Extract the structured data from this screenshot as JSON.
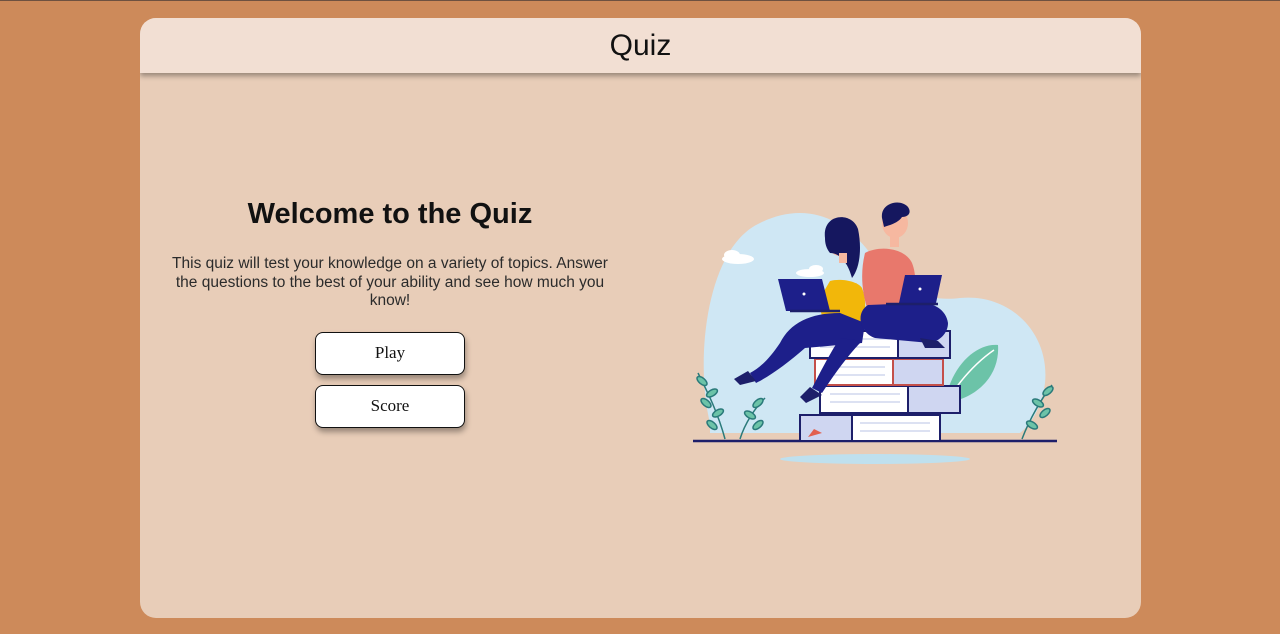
{
  "header": {
    "title": "Quiz"
  },
  "welcome": {
    "heading": "Welcome to the Quiz",
    "description": "This quiz will test your knowledge on a variety of topics. Answer the questions to the best of your ability and see how much you know!"
  },
  "buttons": {
    "play_label": "Play",
    "score_label": "Score"
  },
  "illustration": {
    "icon": "people-studying-on-books-illustration"
  },
  "colors": {
    "page_background": "#cd8a5a",
    "card_background": "#e8cdb8",
    "header_background": "#f2dfd3",
    "accent_navy": "#1d1f8a"
  }
}
